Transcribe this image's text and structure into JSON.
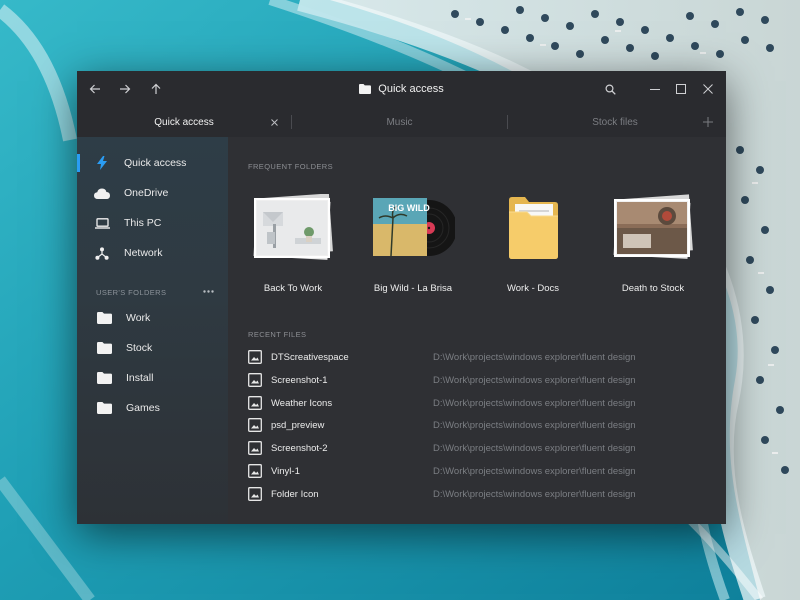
{
  "window": {
    "title": "Quick access",
    "title_icon": "folder-icon",
    "controls": [
      "search-icon",
      "minimize-icon",
      "maximize-icon",
      "close-icon"
    ],
    "nav_buttons": [
      "back-arrow-icon",
      "forward-arrow-icon",
      "up-arrow-icon"
    ]
  },
  "tabs": [
    {
      "label": "Quick access",
      "active": true
    },
    {
      "label": "Music",
      "active": false
    },
    {
      "label": "Stock files",
      "active": false
    }
  ],
  "sidebar": {
    "items": [
      {
        "label": "Quick access",
        "icon": "lightning-icon",
        "active": true
      },
      {
        "label": "OneDrive",
        "icon": "cloud-icon",
        "active": false
      },
      {
        "label": "This PC",
        "icon": "laptop-icon",
        "active": false
      },
      {
        "label": "Network",
        "icon": "network-icon",
        "active": false
      }
    ],
    "section_label": "USER'S FOLDERS",
    "folders": [
      {
        "label": "Work"
      },
      {
        "label": "Stock"
      },
      {
        "label": "Install"
      },
      {
        "label": "Games"
      }
    ]
  },
  "frequent": {
    "heading": "FREQUENT FOLDERS",
    "items": [
      {
        "label": "Back To Work",
        "icon": "photo-stack-icon"
      },
      {
        "label": "Big Wild - La Brisa",
        "icon": "vinyl-record-icon",
        "album_text": "BIG WILD"
      },
      {
        "label": "Work - Docs",
        "icon": "open-folder-icon"
      },
      {
        "label": "Death to Stock",
        "icon": "photo-stack-icon"
      }
    ]
  },
  "recent": {
    "heading": "RECENT FILES",
    "files": [
      {
        "name": "DTScreativespace",
        "path": "D:\\Work\\projects\\windows explorer\\fluent design"
      },
      {
        "name": "Screenshot-1",
        "path": "D:\\Work\\projects\\windows explorer\\fluent design"
      },
      {
        "name": "Weather Icons",
        "path": "D:\\Work\\projects\\windows explorer\\fluent design"
      },
      {
        "name": "psd_preview",
        "path": "D:\\Work\\projects\\windows explorer\\fluent design"
      },
      {
        "name": "Screenshot-2",
        "path": "D:\\Work\\projects\\windows explorer\\fluent design"
      },
      {
        "name": "Vinyl-1",
        "path": "D:\\Work\\projects\\windows explorer\\fluent design"
      },
      {
        "name": "Folder Icon",
        "path": "D:\\Work\\projects\\windows explorer\\fluent design"
      }
    ]
  },
  "colors": {
    "accent": "#2a9df4",
    "window_bg": "#2f3034",
    "titlebar_bg": "#2a2b2f",
    "sidebar_bg": "#2e3d47"
  }
}
